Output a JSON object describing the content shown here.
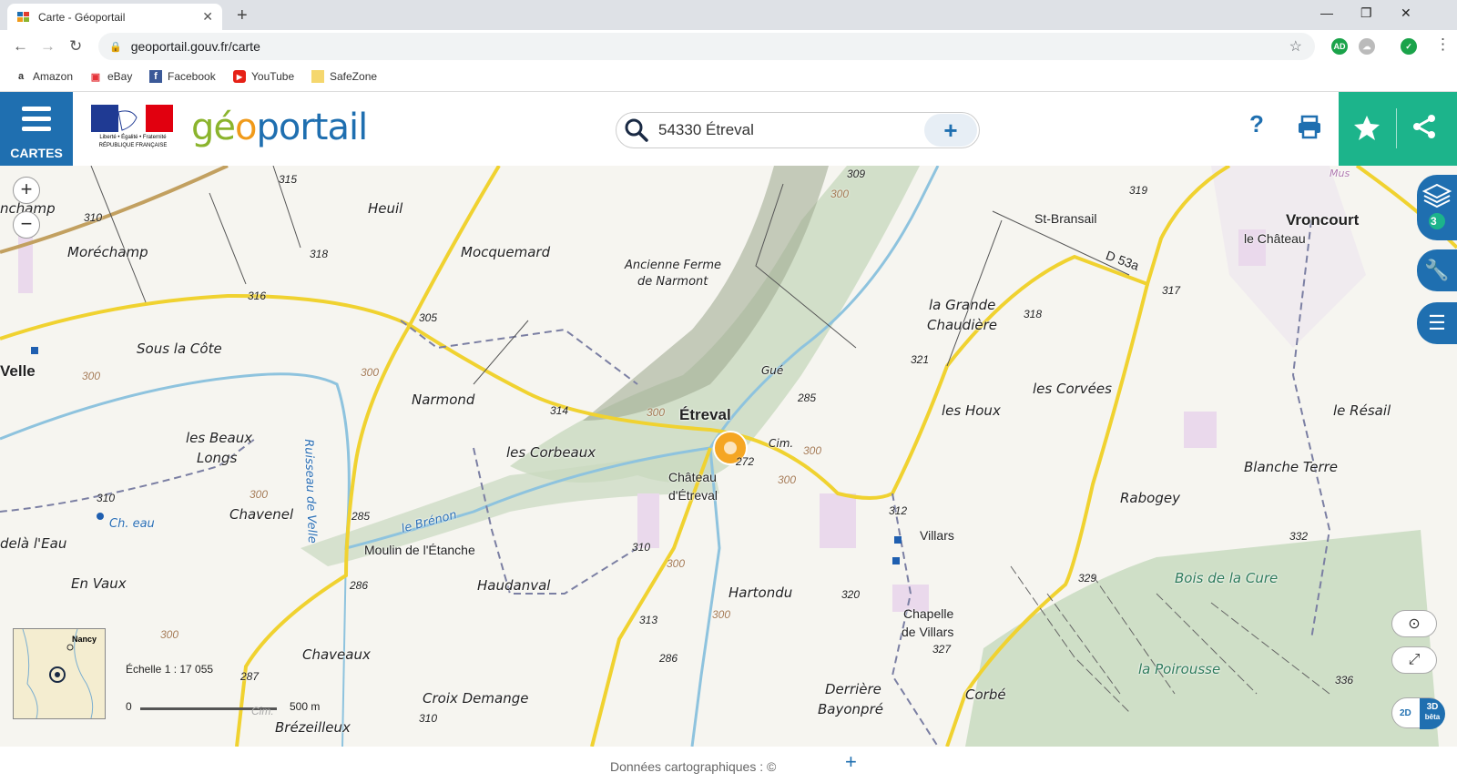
{
  "browser": {
    "tab_title": "Carte - Géoportail",
    "new_tab": "+",
    "url": "geoportail.gouv.fr/carte",
    "bookmarks": [
      "Amazon",
      "eBay",
      "Facebook",
      "YouTube",
      "SafeZone"
    ],
    "window_controls": [
      "—",
      "❐",
      "✕"
    ]
  },
  "header": {
    "menu_label": "CARTES",
    "logo": {
      "part1": "gé",
      "part2": "o",
      "part3": "portail"
    },
    "republique": "Liberté • Égalité • Fraternité RÉPUBLIQUE FRANÇAISE",
    "search_value": "54330 Étreval",
    "search_add": "+",
    "help": "?",
    "colors": {
      "blue": "#1f6fb0",
      "green": "#1cb48b"
    }
  },
  "map": {
    "zoom_in": "+",
    "zoom_out": "−",
    "layers_count": "3",
    "scale_label": "Échelle 1 : 17 055",
    "scale_start": "0",
    "scale_end": "500 m",
    "scale_mid": "Cim.",
    "minimap_label": "Nancy",
    "btn_2d": "2D",
    "btn_3d": "3D",
    "btn_beta": "bêta",
    "place_names": {
      "moréchamp": "Moréchamp",
      "nchamp": "nchamp",
      "heuil": "Heuil",
      "mocquemard": "Mocquemard",
      "ferme1": "Ancienne Ferme",
      "ferme2": "de Narmont",
      "sous_la_cote": "Sous la Côte",
      "velle": "Velle",
      "narmond": "Narmond",
      "beaux1": "les Beaux",
      "beaux2": "Longs",
      "corbeaux": "les Corbeaux",
      "chavenel": "Chavenel",
      "ch_eau": "Ch. eau",
      "dela_leau": "delà l'Eau",
      "en_vaux": "En Vaux",
      "moulin": "Moulin de l'Étanche",
      "haudanval": "Haudanval",
      "chaveaux": "Chaveaux",
      "croix": "Croix Demange",
      "brezeilleux": "Brézeilleux",
      "etreval": "Étreval",
      "chateau1": "Château",
      "chateau2": "d'Étreval",
      "cim": "Cim.",
      "gue": "Gué",
      "hartondu": "Hartondu",
      "derriere1": "Derrière",
      "derriere2": "Bayonpré",
      "grande1": "la Grande",
      "grande2": "Chaudière",
      "les_houx": "les Houx",
      "corvees": "les Corvées",
      "villars": "Villars",
      "chapelle1": "Chapelle",
      "chapelle2": "de Villars",
      "st_bransail": "St-Bransail",
      "d53a": "D 53a",
      "vroncourt": "Vroncourt",
      "le_chateau": "le Château",
      "mus": "Mus",
      "le_resail": "le Résail",
      "blanche_terre": "Blanche Terre",
      "rabogey": "Rabogey",
      "bois_cure": "Bois de la Cure",
      "poirousse": "la Poirousse",
      "corbe": "Corbé",
      "ruisseau": "Ruisseau de Velle",
      "brenon": "le Brénon"
    },
    "altitudes": {
      "a315": "315",
      "a310a": "310",
      "a318": "318",
      "a316": "316",
      "a305": "305",
      "a300a": "300",
      "a300b": "300",
      "a300c": "300",
      "a314": "314",
      "a300d": "300",
      "a272": "272",
      "a285a": "285",
      "a285b": "285",
      "a286a": "286",
      "a286b": "286",
      "a287": "287",
      "a310b": "310",
      "a310c": "310",
      "a310d": "310",
      "a313": "313",
      "a300e": "300",
      "a300f": "300",
      "a300g": "300",
      "a300h": "300",
      "a309": "309",
      "a319": "319",
      "a317": "317",
      "a318b": "318",
      "a321": "321",
      "a312": "312",
      "a320": "320",
      "a327": "327",
      "a329": "329",
      "a332": "332",
      "a336": "336",
      "a300i": "300",
      "a300j": "300"
    }
  },
  "footer": {
    "text": "Données cartographiques : ©",
    "plus": "+"
  }
}
